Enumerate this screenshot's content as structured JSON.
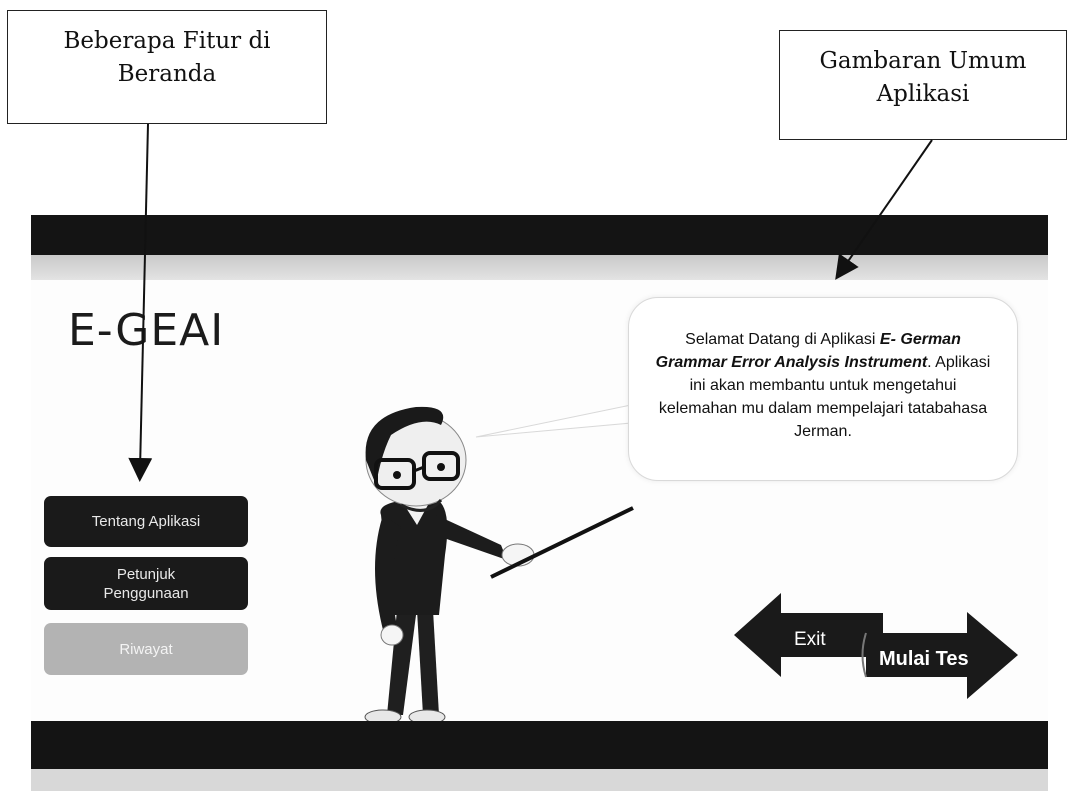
{
  "annotations": {
    "left": "Beberapa Fitur di\nBeranda",
    "right": "Gambaran Umum\nAplikasi"
  },
  "app": {
    "title": "E-GEAI",
    "menu": {
      "tentang": "Tentang Aplikasi",
      "petunjuk": "Petunjuk\nPenggunaan",
      "riwayat": "Riwayat"
    },
    "speech": {
      "pre": "Selamat Datang di Aplikasi ",
      "app_name": "E- German Grammar Error Analysis Instrument",
      "post": ". Aplikasi ini akan membantu untuk mengetahui kelemahan mu dalam mempelajari tatabahasa Jerman."
    },
    "nav": {
      "exit": "Exit",
      "start": "Mulai Tes"
    }
  },
  "colors": {
    "bar": "#141414",
    "button_dark": "#1a1a1a",
    "button_disabled": "#b3b3b3"
  },
  "icons": [
    "teacher-character-illustration",
    "arrow-left-icon",
    "arrow-right-icon"
  ]
}
